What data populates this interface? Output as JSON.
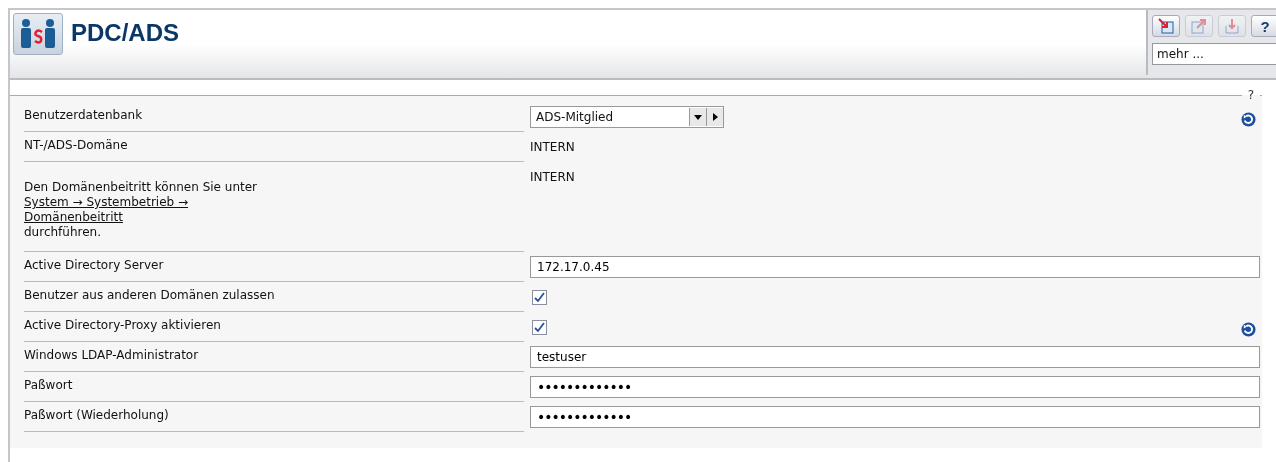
{
  "header": {
    "title": "PDC/ADS",
    "toolbar": [
      {
        "kind": "import",
        "disabled": false
      },
      {
        "kind": "export",
        "disabled": true
      },
      {
        "kind": "download",
        "disabled": true
      },
      {
        "kind": "help",
        "disabled": false,
        "label": "?"
      }
    ],
    "more_select": {
      "value": "mehr ..."
    }
  },
  "form": {
    "legend": "?",
    "rows": [
      {
        "kind": "select",
        "label": "Benutzerdatenbank",
        "value": "ADS-Mitglied",
        "refresh": true
      },
      {
        "kind": "text",
        "label": "NT-/ADS-Domäne",
        "value": "INTERN",
        "refresh": false
      },
      {
        "kind": "note",
        "text": "Den Domänenbeitritt können Sie unter",
        "link": [
          "System → Systembetrieb →",
          "Domänenbeitritt"
        ],
        "after": "durchführen.",
        "value": "INTERN",
        "refresh": false
      },
      {
        "kind": "input",
        "label": "Active Directory Server",
        "value": "172.17.0.45",
        "refresh": false
      },
      {
        "kind": "checkbox",
        "label": "Benutzer aus anderen Domänen zulassen",
        "checked": true,
        "refresh": false
      },
      {
        "kind": "checkbox",
        "label": "Active Directory-Proxy aktivieren",
        "checked": true,
        "refresh": true
      },
      {
        "kind": "input",
        "label": "Windows LDAP-Administrator",
        "value": "testuser",
        "refresh": false
      },
      {
        "kind": "password",
        "label": "Paßwort",
        "value": "•••••••••••••",
        "refresh": false
      },
      {
        "kind": "password",
        "label": "Paßwort (Wiederholung)",
        "value": "•••••••••••••",
        "refresh": false
      }
    ]
  }
}
